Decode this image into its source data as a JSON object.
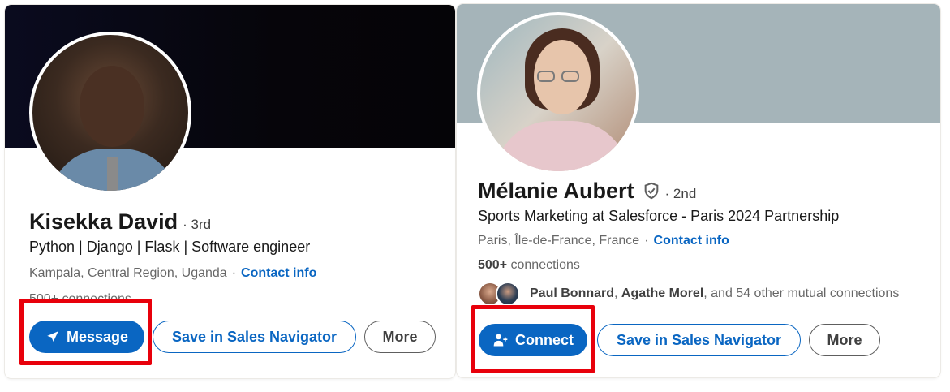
{
  "profiles": [
    {
      "name": "Kisekka David",
      "degree": "· 3rd",
      "headline": "Python | Django | Flask | Software engineer",
      "location": "Kampala, Central Region, Uganda",
      "location_sep": "·",
      "contact_label": "Contact info",
      "connections": "500+ connections",
      "actions": {
        "primary": "Message",
        "primary_icon": "paper-plane-icon",
        "sales_nav": "Save in Sales Navigator",
        "more": "More"
      }
    },
    {
      "name": "Mélanie Aubert",
      "degree": "· 2nd",
      "verified_icon": "verified-shield-icon",
      "headline": "Sports Marketing at Salesforce - Paris 2024 Partnership",
      "location": "Paris, Île-de-France, France",
      "location_sep": "·",
      "contact_label": "Contact info",
      "connections_count": "500+",
      "connections_suffix": "connections",
      "mutual": {
        "name1": "Paul Bonnard",
        "sep": ",",
        "name2": "Agathe Morel",
        "rest": ", and 54 other mutual connections"
      },
      "actions": {
        "primary": "Connect",
        "primary_icon": "add-person-icon",
        "sales_nav": "Save in Sales Navigator",
        "more": "More"
      }
    }
  ],
  "colors": {
    "brand_blue": "#0a66c2",
    "highlight_red": "#e8000b",
    "banner_gray": "#a5b4b9"
  }
}
